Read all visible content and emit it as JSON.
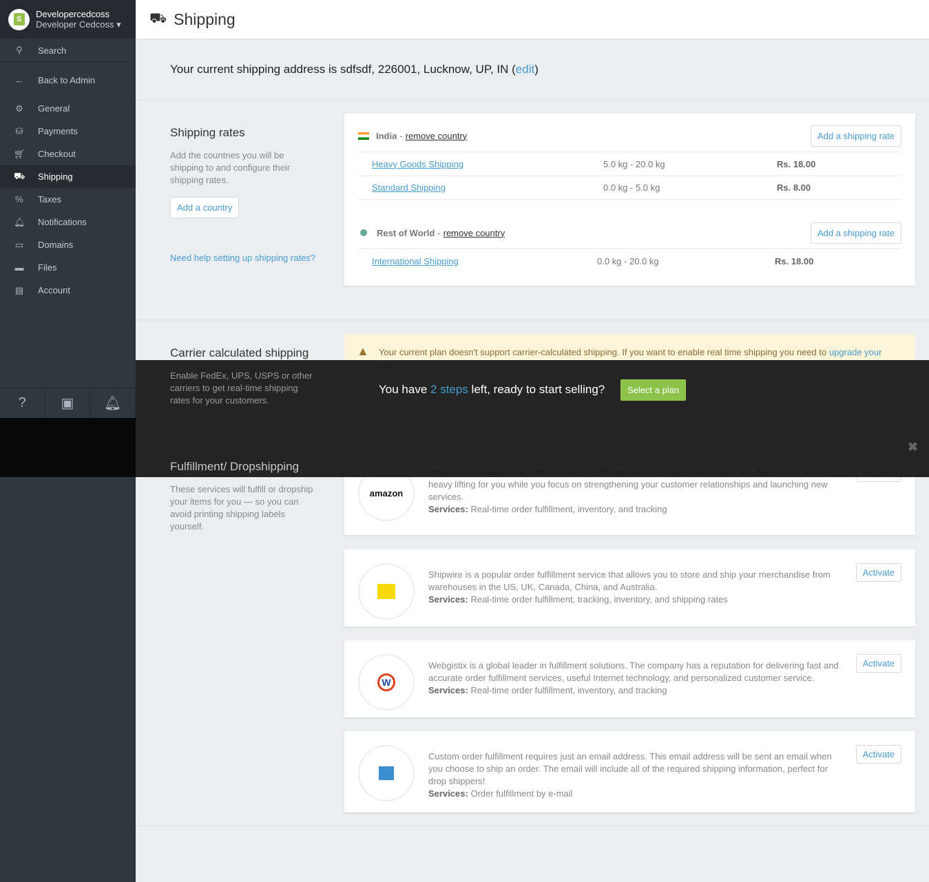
{
  "sidebar": {
    "store": "Developercedcoss",
    "user": "Developer Cedcoss",
    "search": "Search",
    "back": "Back to Admin",
    "items": [
      {
        "label": "General"
      },
      {
        "label": "Payments"
      },
      {
        "label": "Checkout"
      },
      {
        "label": "Shipping"
      },
      {
        "label": "Taxes"
      },
      {
        "label": "Notifications"
      },
      {
        "label": "Domains"
      },
      {
        "label": "Files"
      },
      {
        "label": "Account"
      }
    ]
  },
  "header": {
    "title": "Shipping"
  },
  "address": {
    "text": "Your current shipping address is sdfsdf, 226001, Lucknow, UP, IN (",
    "edit": "edit",
    "close": ")"
  },
  "rates": {
    "title": "Shipping rates",
    "desc": "Add the countries you will be shipping to and configure their shipping rates.",
    "add_country": "Add a country",
    "help": "Need help setting up shipping rates?",
    "countries": [
      {
        "name": "India",
        "remove": "remove country",
        "add_rate": "Add a shipping rate",
        "rates": [
          {
            "name": "Heavy Goods Shipping",
            "weight": "5.0 kg - 20.0 kg",
            "price": "Rs. 18.00"
          },
          {
            "name": "Standard Shipping",
            "weight": "0.0 kg - 5.0 kg",
            "price": "Rs. 8.00"
          }
        ]
      },
      {
        "name": "Rest of World",
        "remove": "remove country",
        "add_rate": "Add a shipping rate",
        "rates": [
          {
            "name": "International Shipping",
            "weight": "0.0 kg - 20.0 kg",
            "price": "Rs. 18.00"
          }
        ]
      }
    ]
  },
  "carrier": {
    "title": "Carrier calculated shipping",
    "desc": "Enable FedEx, UPS, USPS or other carriers to get real-time shipping rates for your customers.",
    "notice": "Your current plan doesn't support carrier-calculated shipping. If you want to enable real time shipping you need to ",
    "upgrade": "upgrade your plan",
    "notice_end": "."
  },
  "fulfillment": {
    "title": "Fulfillment/ Dropshipping",
    "desc": "These services will fulfill or dropship your items for you — so you can avoid printing shipping labels yourself.",
    "services_label": "Services:",
    "activate": "Activate",
    "providers": [
      {
        "logo": "amazon",
        "text": "Amazon is a leader in ecommerce and has the experience that people expect and trust. Let us do the heavy lifting for you while you focus on strengthening your customer relationships and launching new services.",
        "services": "Real-time order fulfillment, inventory, and tracking"
      },
      {
        "logo": "shipwire",
        "text": "Shipwire is a popular order fulfillment service that allows you to store and ship your merchandise from warehouses in the US, UK, Canada, China, and Australia.",
        "services": "Real-time order fulfillment, tracking, inventory, and shipping rates"
      },
      {
        "logo": "webgistix",
        "text": "Webgistix is a global leader in fulfillment solutions. The company has a reputation for delivering fast and accurate order fulfillment services, useful Internet technology, and personalized customer service.",
        "services": "Real-time order fulfillment, inventory, and tracking"
      },
      {
        "logo": "custom",
        "text": "Custom order fulfillment requires just an email address. This email address will be sent an email when you choose to ship an order. The email will include all of the required shipping information, perfect for drop shippers!",
        "services": "Order fulfillment by e-mail"
      }
    ]
  },
  "overlay": {
    "pre": "You have ",
    "steps": "2 steps",
    "post": " left, ready to start selling?",
    "button": "Select a plan",
    "close": "✖"
  }
}
